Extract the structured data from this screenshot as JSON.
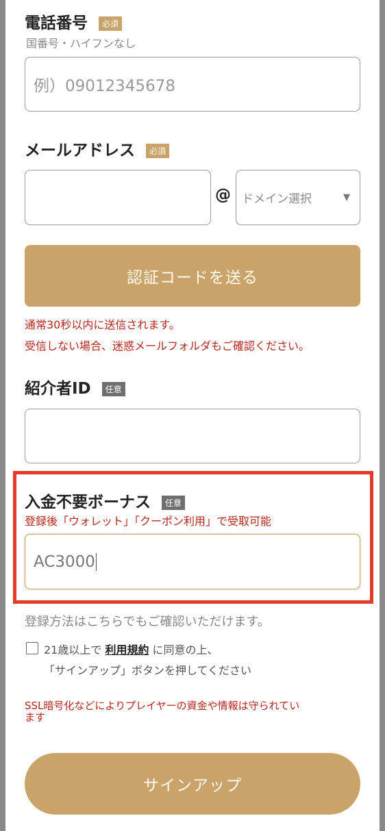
{
  "required_badge": "必須",
  "optional_badge": "任意",
  "phone": {
    "label": "電話番号",
    "hint": "国番号・ハイフンなし",
    "placeholder": "例）09012345678"
  },
  "email": {
    "label": "メールアドレス",
    "at": "@",
    "domain_select": "ドメイン選択",
    "dropdown_glyph": "▼"
  },
  "send_code_button": "認証コードを送る",
  "send_notes": [
    "通常30秒以内に送信されます。",
    "受信しない場合、迷惑メールフォルダもご確認ください。"
  ],
  "referrer": {
    "label": "紹介者ID"
  },
  "bonus": {
    "label": "入金不要ボーナス",
    "note": "登録後「ウォレット」「クーポン利用」で受取可能",
    "value": "AC3000"
  },
  "registration_info": "登録方法はこちらでもご確認いただけます。",
  "terms": {
    "prefix": "21歳以上で ",
    "link": "利用規約",
    "suffix": " に同意の上、",
    "line2": "「サインアップ」ボタンを押してください"
  },
  "security_note": {
    "line1": "SSL暗号化などによりプレイヤーの資金や情報は守られてい",
    "line2": "ます"
  },
  "signup_button": "サインアップ",
  "colors": {
    "accent": "#c9a36a",
    "error_red": "#b3261e",
    "highlight_red": "#e23b2a"
  }
}
